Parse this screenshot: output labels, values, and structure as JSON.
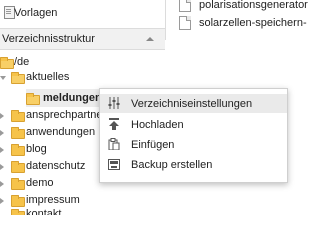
{
  "top_left": {
    "item_label": "Vorlagen",
    "icon": "template-icon"
  },
  "tree_panel": {
    "title": "Verzeichnisstruktur"
  },
  "file_list": [
    {
      "name": "polarisationsgenerator",
      "icon": "file-icon"
    },
    {
      "name": "solarzellen-speichern-",
      "icon": "file-icon"
    }
  ],
  "tree": {
    "root": "/de",
    "items": [
      {
        "label": "aktuelles",
        "expanded": true
      },
      {
        "label": "meldungen",
        "selected": true
      },
      {
        "label": "ansprechpartner"
      },
      {
        "label": "anwendungen"
      },
      {
        "label": "blog"
      },
      {
        "label": "datenschutz"
      },
      {
        "label": "demo"
      },
      {
        "label": "impressum"
      },
      {
        "label": "kontakt"
      }
    ]
  },
  "context_menu": [
    {
      "label": "Verzeichniseinstellungen",
      "icon": "settings-sliders-icon"
    },
    {
      "label": "Hochladen",
      "icon": "upload-icon"
    },
    {
      "label": "Einfügen",
      "icon": "paste-icon"
    },
    {
      "label": "Backup erstellen",
      "icon": "backup-icon"
    }
  ],
  "colors": {
    "folder": "#f6c34a",
    "menu_hover": "#eaeaea",
    "header_bg": "#f1f1f1"
  }
}
